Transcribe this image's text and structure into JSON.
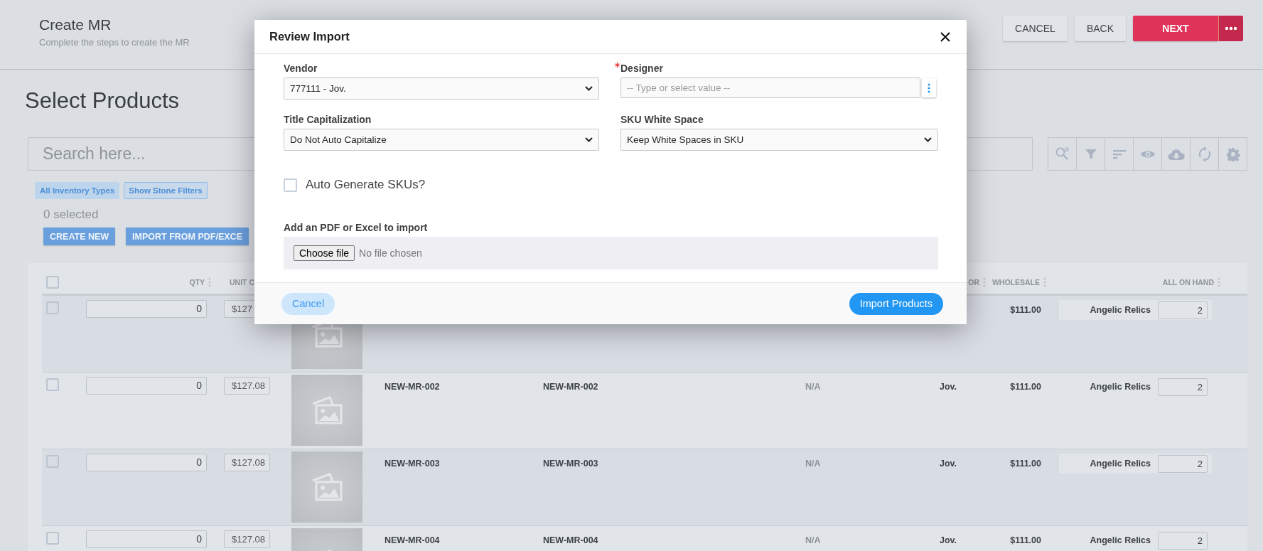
{
  "header": {
    "title": "Create MR",
    "subtitle": "Complete the steps to create the MR",
    "buttons": [
      {
        "label": "CANCEL",
        "kind": "plain"
      },
      {
        "label": "BACK",
        "kind": "plain"
      },
      {
        "label": "NEXT",
        "kind": "primary"
      }
    ]
  },
  "section_title": "Select Products",
  "search": {
    "placeholder": "Search here..."
  },
  "chips": [
    {
      "label": "All Inventory Types",
      "kind": "filled"
    },
    {
      "label": "Show Stone Filters",
      "kind": "outline"
    }
  ],
  "selected_count": "0 selected",
  "actions": [
    "CREATE NEW",
    "IMPORT FROM PDF/EXCE"
  ],
  "table": {
    "header": {
      "checked": false,
      "qty": "QTY",
      "column_3": "UNIT C",
      "column_8": "OR",
      "wholesale": "WHOLESALE",
      "all_on_hand": "ALL ON HAND"
    },
    "rows": [
      {
        "checked": false,
        "qty": "0",
        "column_3": "$127",
        "wholesale": "$111.00",
        "location": "Angelic Relics",
        "all_on_hand": "2"
      },
      {
        "checked": false,
        "qty": "0",
        "column_3": "$127.08",
        "column_5": "NEW-MR-002",
        "column_6": "NEW-MR-002",
        "column_7": "N/A",
        "column_8": "Jov.",
        "wholesale": "$111.00",
        "location": "Angelic Relics",
        "all_on_hand": "2"
      },
      {
        "checked": false,
        "qty": "0",
        "column_3": "$127.08",
        "column_5": "NEW-MR-003",
        "column_6": "NEW-MR-003",
        "column_7": "N/A",
        "column_8": "Jov.",
        "wholesale": "$111.00",
        "location": "Angelic Relics",
        "all_on_hand": "2"
      },
      {
        "checked": false,
        "qty": "0",
        "column_3": "$127.08",
        "column_5": "NEW-MR-004",
        "column_6": "NEW-MR-004",
        "column_7": "N/A",
        "column_8": "Jov.",
        "wholesale": "$111.00",
        "location": "Angelic Relics",
        "all_on_hand": "2"
      }
    ]
  },
  "modal": {
    "title": "Review Import",
    "fields": [
      {
        "label": "Vendor",
        "kind": "select",
        "value": "777111 - Jov.",
        "required": false
      },
      {
        "label": "Designer",
        "kind": "combo",
        "placeholder": "-- Type or select value --",
        "required": true
      },
      {
        "label": "Title Capitalization",
        "kind": "select",
        "value": "Do Not Auto Capitalize",
        "required": false
      },
      {
        "label": "SKU White Space",
        "kind": "select",
        "value": "Keep White Spaces in SKU",
        "required": false
      }
    ],
    "auto_generate": {
      "label": "Auto Generate SKUs?",
      "checked": false
    },
    "file": {
      "label": "Add an PDF or Excel to import",
      "button": "Choose file",
      "status": "No file chosen"
    },
    "buttons": [
      {
        "label": "Cancel",
        "kind": "secondary"
      },
      {
        "label": "Import Products",
        "kind": "primary"
      }
    ]
  }
}
